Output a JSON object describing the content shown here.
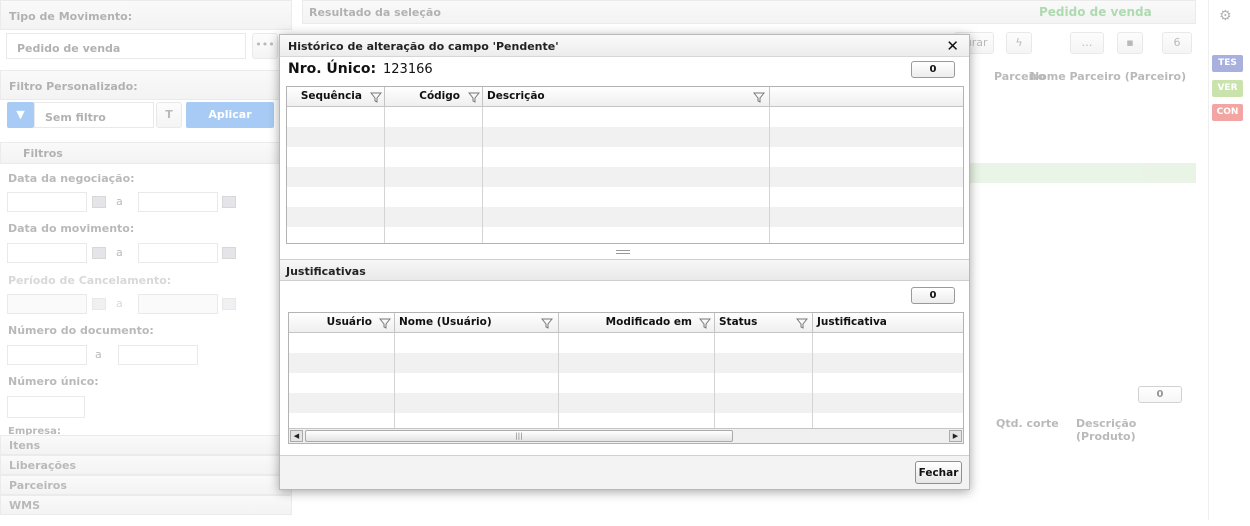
{
  "left_panel": {
    "tipo_label": "Tipo de Movimento:",
    "tipo_value": "Pedido de venda",
    "filtro_label": "Filtro Personalizado:",
    "filtro_value": "Sem filtro",
    "aplicar_label": "Aplicar",
    "filtros_header": "Filtros",
    "data_negociacao": "Data da negociação:",
    "data_movimento": "Data do movimento:",
    "periodo_cancelamento": "Período de Cancelamento:",
    "numero_documento": "Número do documento:",
    "numero_unico": "Número único:",
    "empresa": "Empresa:",
    "separator_a": "a",
    "accordion": [
      "Itens",
      "Liberações",
      "Parceiros",
      "WMS"
    ]
  },
  "right_panel": {
    "title": "Resultado da seleção",
    "tipo_badge": "Pedido de venda",
    "faturar_label": "turar",
    "page_count": "6",
    "col_parceiro": "Parceiro",
    "col_nome_parceiro": "Nome Parceiro (Parceiro)",
    "bottom_count": "0",
    "col_qtd_corte": "Qtd. corte",
    "col_desc_produto": "Descrição (Produto)"
  },
  "side_tags": [
    {
      "label": "TES",
      "color": "#3f51b5"
    },
    {
      "label": "VER",
      "color": "#8bc34a"
    },
    {
      "label": "CON",
      "color": "#e53935"
    }
  ],
  "dialog": {
    "title": "Histórico de alteração do campo 'Pendente'",
    "nro_label": "Nro. Único:",
    "nro_value": "123166",
    "top_count": "0",
    "top_columns": [
      "Sequência",
      "Código",
      "Descrição"
    ],
    "justificativas_title": "Justificativas",
    "bottom_count": "0",
    "bottom_columns": [
      "Usuário",
      "Nome (Usuário)",
      "Modificado em",
      "Status",
      "Justificativa"
    ],
    "close_button": "Fechar"
  }
}
